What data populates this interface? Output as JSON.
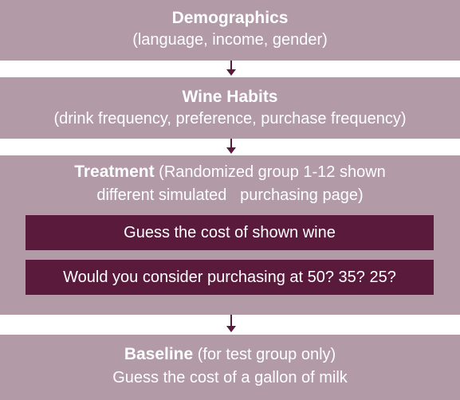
{
  "steps": {
    "demographics": {
      "title": "Demographics",
      "detail": "(language, income, gender)"
    },
    "wine_habits": {
      "title": "Wine Habits",
      "detail": "(drink frequency, preference, purchase frequency)"
    },
    "treatment": {
      "title": "Treatment",
      "detail_line1": "(Randomized group 1-12 shown",
      "detail_line2": "different simulated   purchasing page)",
      "tasks": [
        "Guess the cost of shown wine",
        "Would you consider purchasing at 50? 35? 25?"
      ]
    },
    "baseline": {
      "title": "Baseline",
      "detail": "(for test group only)",
      "line2": "Guess the cost of a gallon of milk"
    }
  },
  "colors": {
    "box": "#b29aa7",
    "inner": "#5a1a3c",
    "arrow": "#5a1a3c",
    "text": "#ffffff"
  }
}
